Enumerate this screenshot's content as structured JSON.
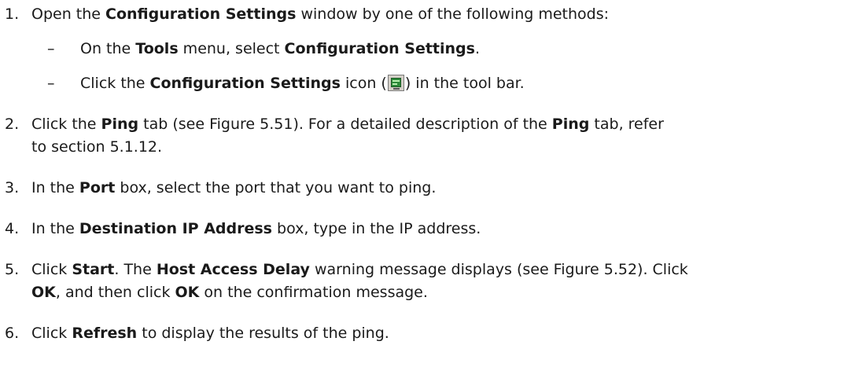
{
  "steps": [
    {
      "number": "1.",
      "parts": {
        "a": "Open the ",
        "b": "Configuration Settings",
        "c": " window by one of the following methods:"
      },
      "substeps": [
        {
          "dash": "–",
          "a": "On the ",
          "b": "Tools",
          "c": " menu, select ",
          "d": "Configuration Settings",
          "e": "."
        },
        {
          "dash": "–",
          "a": "Click the ",
          "b": "Configuration Settings",
          "c": " icon (",
          "icon": "configuration-settings-icon",
          "d": ") in the tool bar."
        }
      ]
    },
    {
      "number": "2.",
      "line1": {
        "a": "Click the ",
        "b": "Ping",
        "c": " tab (see Figure 5.51). For a detailed description of the ",
        "d": "Ping",
        "e": " tab, refer"
      },
      "line2": "to section 5.1.12."
    },
    {
      "number": "3.",
      "parts": {
        "a": "In the ",
        "b": "Port",
        "c": " box, select the port that you want to ping."
      }
    },
    {
      "number": "4.",
      "parts": {
        "a": "In the ",
        "b": "Destination IP Address",
        "c": " box, type in the IP address."
      }
    },
    {
      "number": "5.",
      "line1": {
        "a": "Click ",
        "b": "Start",
        "c": ". The ",
        "d": "Host Access Delay",
        "e": " warning message displays (see Figure 5.52). Click"
      },
      "line2": {
        "a": "OK",
        "b": ", and then click ",
        "c": "OK",
        "d": " on the confirmation message."
      }
    },
    {
      "number": "6.",
      "parts": {
        "a": "Click ",
        "b": "Refresh",
        "c": " to display the results of the ping."
      }
    }
  ]
}
